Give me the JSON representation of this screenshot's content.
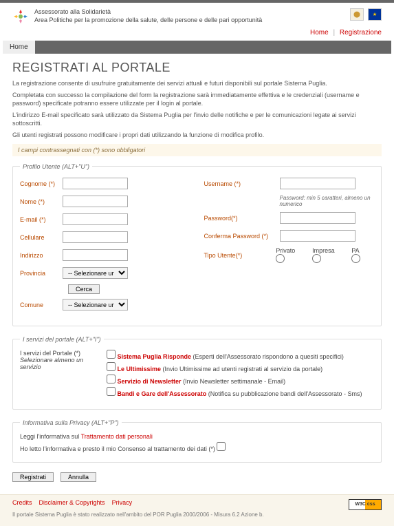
{
  "header": {
    "org1": "Assessorato alla Solidarietà",
    "org2": "Area Politiche per la promozione della salute, delle persone e delle pari opportunità"
  },
  "topnav": {
    "home": "Home",
    "registrazione": "Registrazione"
  },
  "mainnav": {
    "home": "Home"
  },
  "page": {
    "title": "REGISTRATI AL PORTALE",
    "intro1": "La registrazione consente di usufruire gratuitamente dei servizi attuali e futuri disponibili sul portale Sistema Puglia.",
    "intro2": "Completata con successo la compilazione del form la registrazione sarà immediatamente effettiva e le credenziali (username e password) specificate potranno essere utilizzate per il login al portale.",
    "intro3": "L'indirizzo E-mail specificato sarà utilizzato da Sistema Puglia per l'invio delle notifiche e per le comunicazioni legate ai servizi sottoscritti.",
    "intro4": "Gli utenti registrati possono modificare i propri dati utilizzando la funzione di modifica profilo.",
    "required_note": "I campi contrassegnati con (*) sono obbligatori"
  },
  "fieldset_profilo": {
    "legend": "Profilo Utente (ALT+\"U\")",
    "cognome": "Cognome (*)",
    "nome": "Nome (*)",
    "email": "E-mail (*)",
    "cellulare": "Cellulare",
    "indirizzo": "Indirizzo",
    "provincia": "Provincia",
    "provincia_placeholder": "-- Selezionare una Provincia --",
    "cerca": "Cerca",
    "comune": "Comune",
    "comune_placeholder": "-- Selezionare un Comune --",
    "username": "Username (*)",
    "pw_hint": "Password: min 5 caratteri, almeno un numerico",
    "password": "Password(*)",
    "conferma_password": "Conferma Password (*)",
    "tipo_utente": "Tipo Utente(*)",
    "tipo_privato": "Privato",
    "tipo_impresa": "Impresa",
    "tipo_pa": "PA"
  },
  "fieldset_servizi": {
    "legend": "I servizi del portale (ALT+\"I\")",
    "label_main": "I servizi del Portale (*)",
    "label_sub": "Selezionare almeno un servizio",
    "svc1_name": "Sistema Puglia Risponde",
    "svc1_desc": " (Esperti dell'Assessorato rispondono a quesiti specifici)",
    "svc2_name": "Le Ultimissime",
    "svc2_desc": " (Invio Ultimissime ad utenti registrati al servizio da portale)",
    "svc3_name": "Servizio di Newsletter",
    "svc3_desc": " (Invio Newsletter settimanale - Email)",
    "svc4_name": "Bandi e Gare dell'Assessorato",
    "svc4_desc": " (Notifica su pubblicazione bandi dell'Assessorato - Sms)"
  },
  "fieldset_privacy": {
    "legend": "Informativa sulla Privacy (ALT+\"P\")",
    "line1_pre": "Leggi l'informativa sul ",
    "line1_link": "Trattamento dati personali",
    "line2": "Ho letto l'informativa e presto il mio Consenso al trattamento dei dati (*)"
  },
  "actions": {
    "registrati": "Registrati",
    "annulla": "Annulla"
  },
  "footer": {
    "credits": "Credits",
    "disclaimer": "Disclaimer & Copyrights",
    "privacy": "Privacy",
    "note": "Il portale Sistema Puglia è stato realizzato nell'ambito del POR Puglia 2000/2006 - Misura 6.2 Azione b.",
    "css_badge": "W3C css"
  }
}
